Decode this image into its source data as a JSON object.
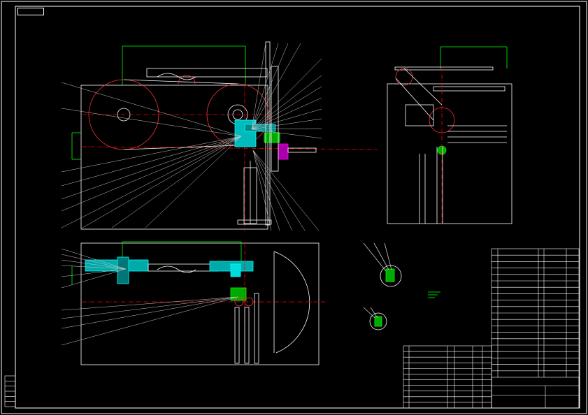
{
  "sheet": {
    "stamp": "",
    "views": [
      "front-view",
      "top-view",
      "side-view",
      "detail-view-a",
      "detail-view-b"
    ]
  },
  "colors": {
    "background": "#000000",
    "outline": "#ffffff",
    "dimension": "#00ff00",
    "centerline": "#ff0000",
    "hatch": "#00ffff",
    "highlight": "#ff00ff",
    "leader": "#c8c8c8"
  },
  "title_block": {
    "rows": 20,
    "columns": 7,
    "vertical_text": "",
    "drawing_number": ""
  },
  "parts_list": {
    "rows": 11,
    "columns": 6
  },
  "revision_strip": {
    "rows": 6
  }
}
